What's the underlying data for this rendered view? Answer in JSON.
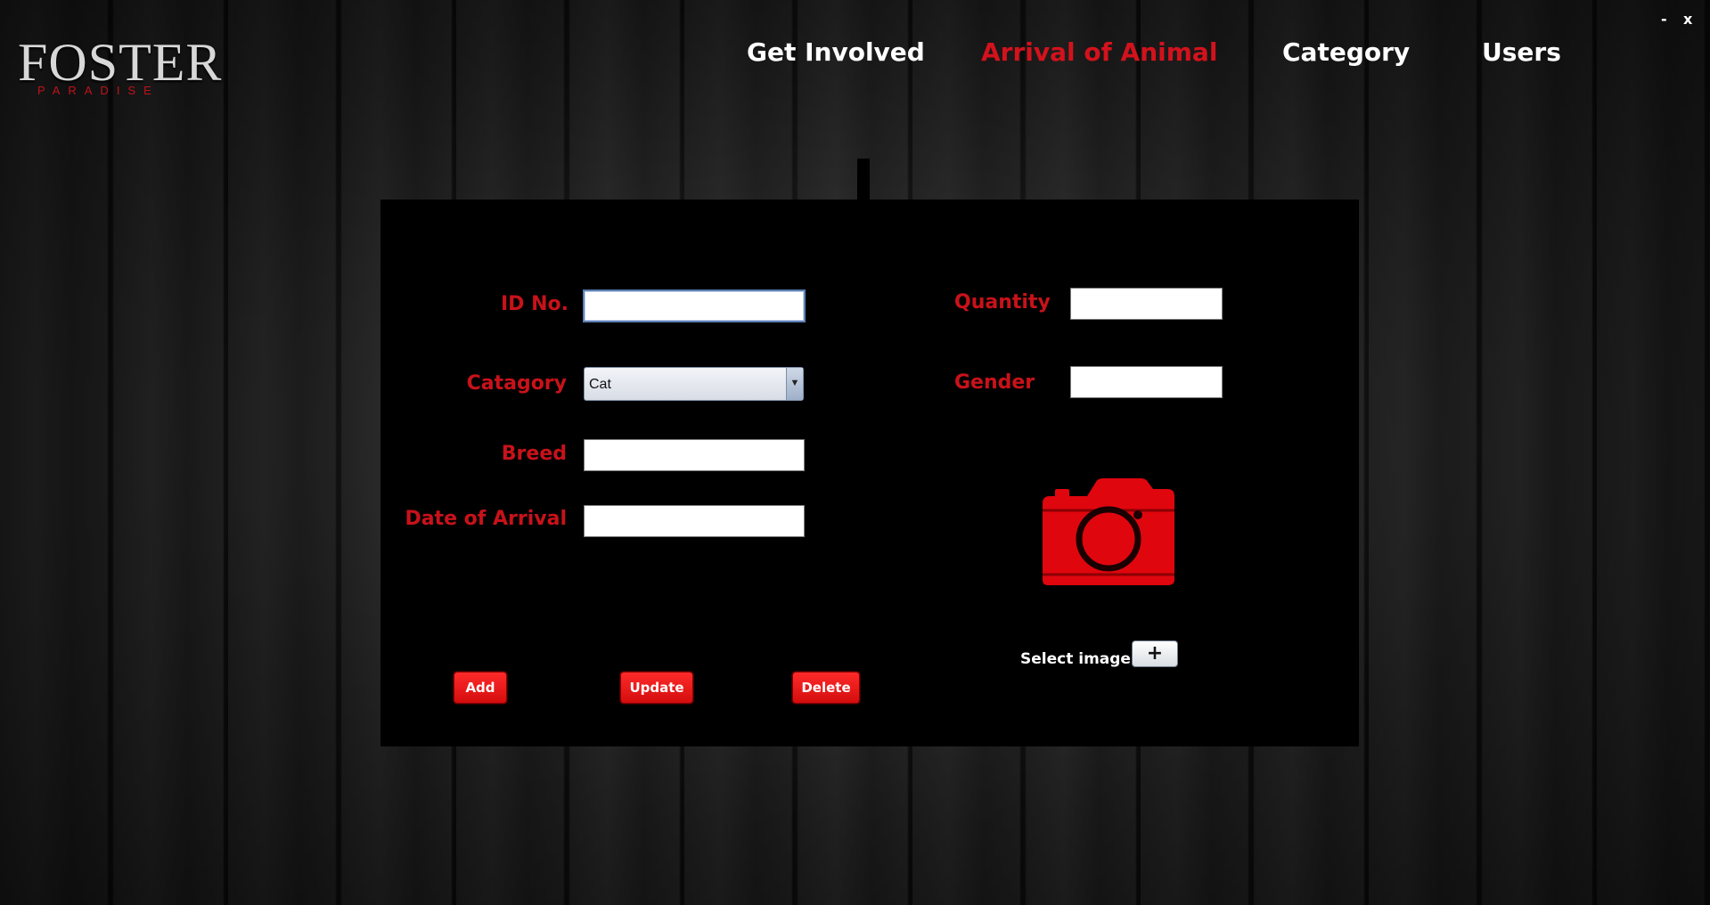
{
  "app": {
    "logo_text": "FOSTER",
    "logo_subtext": "PARADISE"
  },
  "window_controls": {
    "minimize": "-",
    "close": "x"
  },
  "nav": {
    "items": [
      {
        "label": "Get Involved",
        "active": false
      },
      {
        "label": "Arrival of Animal",
        "active": true
      },
      {
        "label": "Category",
        "active": false
      },
      {
        "label": "Users",
        "active": false
      }
    ],
    "active_color": "#d2121c"
  },
  "form": {
    "id_label": "ID No.",
    "id_value": "",
    "category_label": "Catagory",
    "category_value": "Cat",
    "breed_label": "Breed",
    "breed_value": "",
    "date_label": "Date of Arrival",
    "date_value": "",
    "quantity_label": "Quantity",
    "quantity_value": "",
    "gender_label": "Gender",
    "gender_value": ""
  },
  "actions": {
    "add_label": "Add",
    "update_label": "Update",
    "delete_label": "Delete"
  },
  "image": {
    "icon": "camera-icon",
    "select_label": "Select image",
    "plus_label": "+"
  },
  "colors": {
    "accent": "#c8121a",
    "panel": "#000000"
  }
}
